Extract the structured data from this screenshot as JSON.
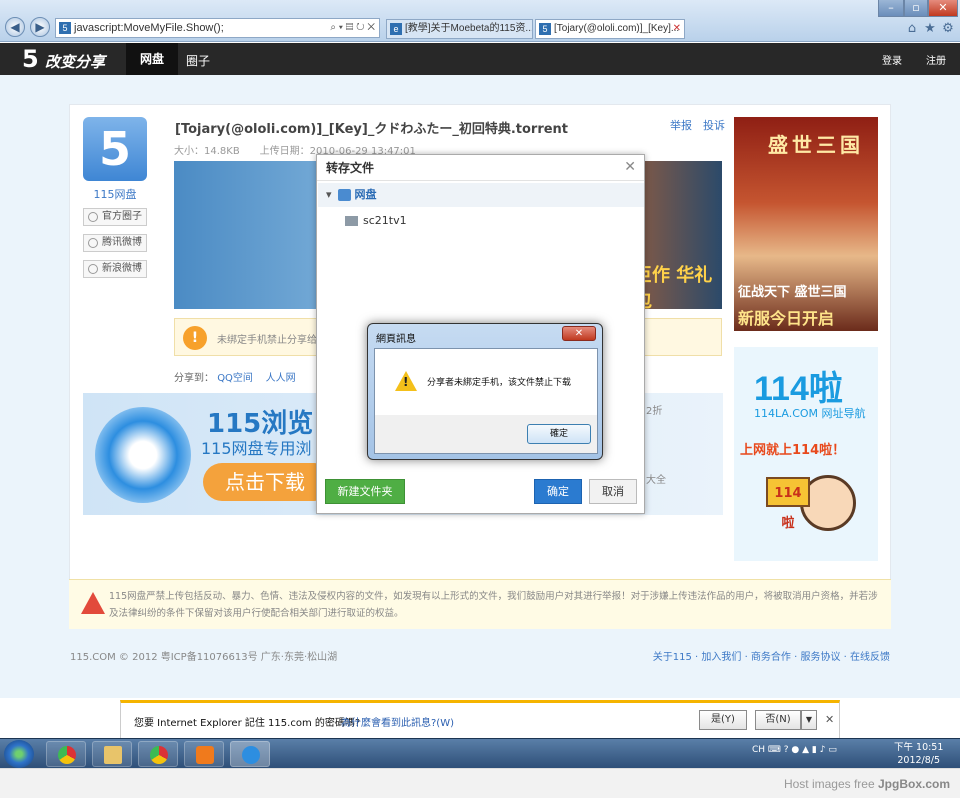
{
  "browser": {
    "address": "javascript:MoveMyFile.Show();",
    "tabs": [
      {
        "label": "[教學]关于Moebeta的115资..."
      },
      {
        "label": "[Tojary(@ololi.com)]_[Key]..."
      }
    ]
  },
  "sitenav": {
    "logo_num": "5",
    "logo_text": "改变分享",
    "items": [
      "网盘",
      "圈子"
    ],
    "login": "登录",
    "register": "注册"
  },
  "uploader": {
    "icon_letter": "5",
    "name": "115网盘",
    "buttons": [
      "官方圈子",
      "腾讯微博",
      "新浪微博"
    ]
  },
  "file": {
    "title": "[Tojary(@ololi.com)]_[Key]_クドわふたー_初回特典.torrent",
    "meta": "大小：14.8KB　　上传日期：2010-06-29 13:47:01",
    "report": "举报",
    "complain": "投诉"
  },
  "banner1": {
    "text": "巨作 华礼包"
  },
  "warning": {
    "text": "未绑定手机禁止分享给"
  },
  "share": {
    "label": "分享到：",
    "qq": "QQ空间",
    "renren": "人人网"
  },
  "banner2": {
    "headline": "115浏览",
    "sub": "115网盘专用浏",
    "download": "点击下载"
  },
  "right_texts": [
    "2折",
    "大全"
  ],
  "ad1": {
    "title": "盛世三国",
    "line1": "征战天下 盛世三国",
    "line2": "新服今日开启"
  },
  "ad2": {
    "brand": "114啦",
    "domain": "114LA.COM 网址导航",
    "slogan": "上网就上114啦！",
    "sign": "114啦"
  },
  "legal": {
    "text": "115网盘严禁上传包括反动、暴力、色情、违法及侵权内容的文件，如发現有以上形式的文件，我们鼓励用户对其进行举报！对于涉嫌上传违法作品的用户，将被取消用户资格，并若涉及法律纠纷的条件下保留对该用户行使配合相关部门进行取证的权益。"
  },
  "footer": {
    "copyright": "115.COM © 2012 粤ICP备11076613号 广东·东莞·松山湖",
    "links": "关于115 · 加入我们 · 商务合作 · 服务协议 · 在线反馈"
  },
  "save_dialog": {
    "title": "转存文件",
    "root": "网盘",
    "folder": "sc21tv1",
    "new_folder": "新建文件夹",
    "ok": "确定",
    "cancel": "取消"
  },
  "alert": {
    "title": "網頁訊息",
    "message": "分享者未綁定手机，该文件禁止下载",
    "ok": "確定"
  },
  "infobar": {
    "question": "您要 Internet Explorer 記住 115.com 的密碼嗎?",
    "why": "為什麼會看到此訊息?(W)",
    "yes": "是(Y)",
    "no": "否(N)"
  },
  "taskbar": {
    "tray": "CH",
    "time": "下午 10:51",
    "date": "2012/8/5"
  },
  "credit": {
    "text": "Host images free",
    "brand": "JpgBox.com"
  }
}
